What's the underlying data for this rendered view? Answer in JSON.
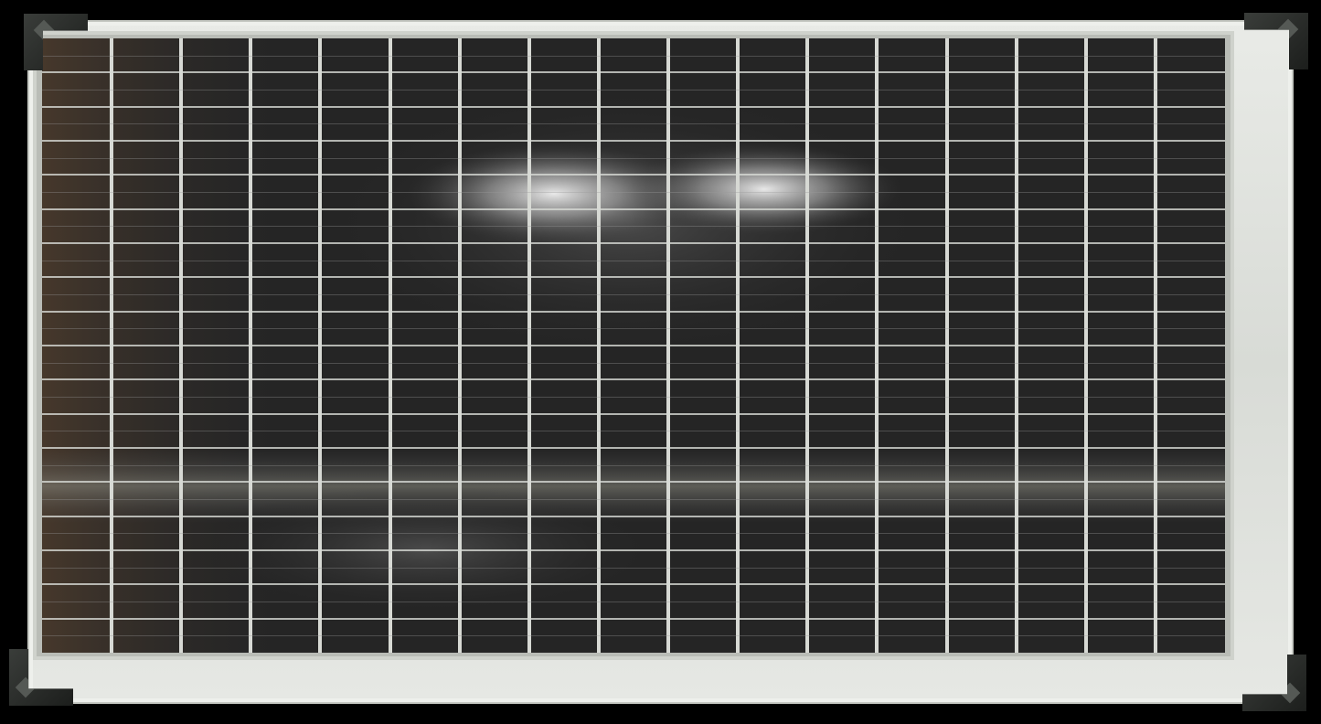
{
  "photo": {
    "subject": "",
    "colors": {
      "background": "#000000",
      "frame": "#e2e4e0",
      "cell": "#2a2a2a",
      "grid_line": "#d7d9d4",
      "glare": "#f4f4f4",
      "corner_cap": "#262826"
    },
    "panel": {
      "cell_columns": 17,
      "cell_rows": 18
    }
  }
}
